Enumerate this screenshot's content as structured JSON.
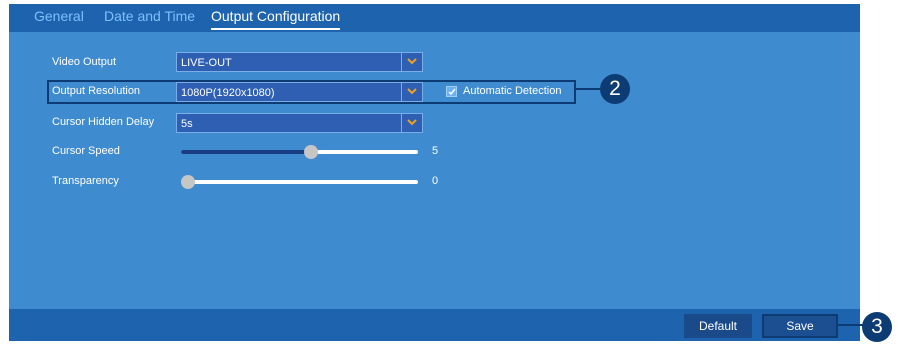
{
  "tabs": [
    {
      "label": "General"
    },
    {
      "label": "Date and Time"
    },
    {
      "label": "Output Configuration"
    }
  ],
  "settings": {
    "video_output": {
      "label": "Video Output",
      "value": "LIVE-OUT"
    },
    "output_resolution": {
      "label": "Output Resolution",
      "value": "1080P(1920x1080)"
    },
    "automatic_detection": {
      "label": "Automatic Detection",
      "checked": true
    },
    "cursor_hidden_delay": {
      "label": "Cursor Hidden Delay",
      "value": "5s"
    },
    "cursor_speed": {
      "label": "Cursor Speed",
      "value": "5",
      "level_fraction": 0.55
    },
    "transparency": {
      "label": "Transparency",
      "value": "0",
      "level_fraction": 0.0
    }
  },
  "footer": {
    "default_label": "Default",
    "save_label": "Save"
  },
  "callouts": {
    "resolution": "2",
    "save": "3"
  },
  "colors": {
    "panel": "#3f8bd0",
    "bar": "#1d63ad",
    "callout": "#0d3b73",
    "dropdown_arrow": "#f0a020"
  }
}
